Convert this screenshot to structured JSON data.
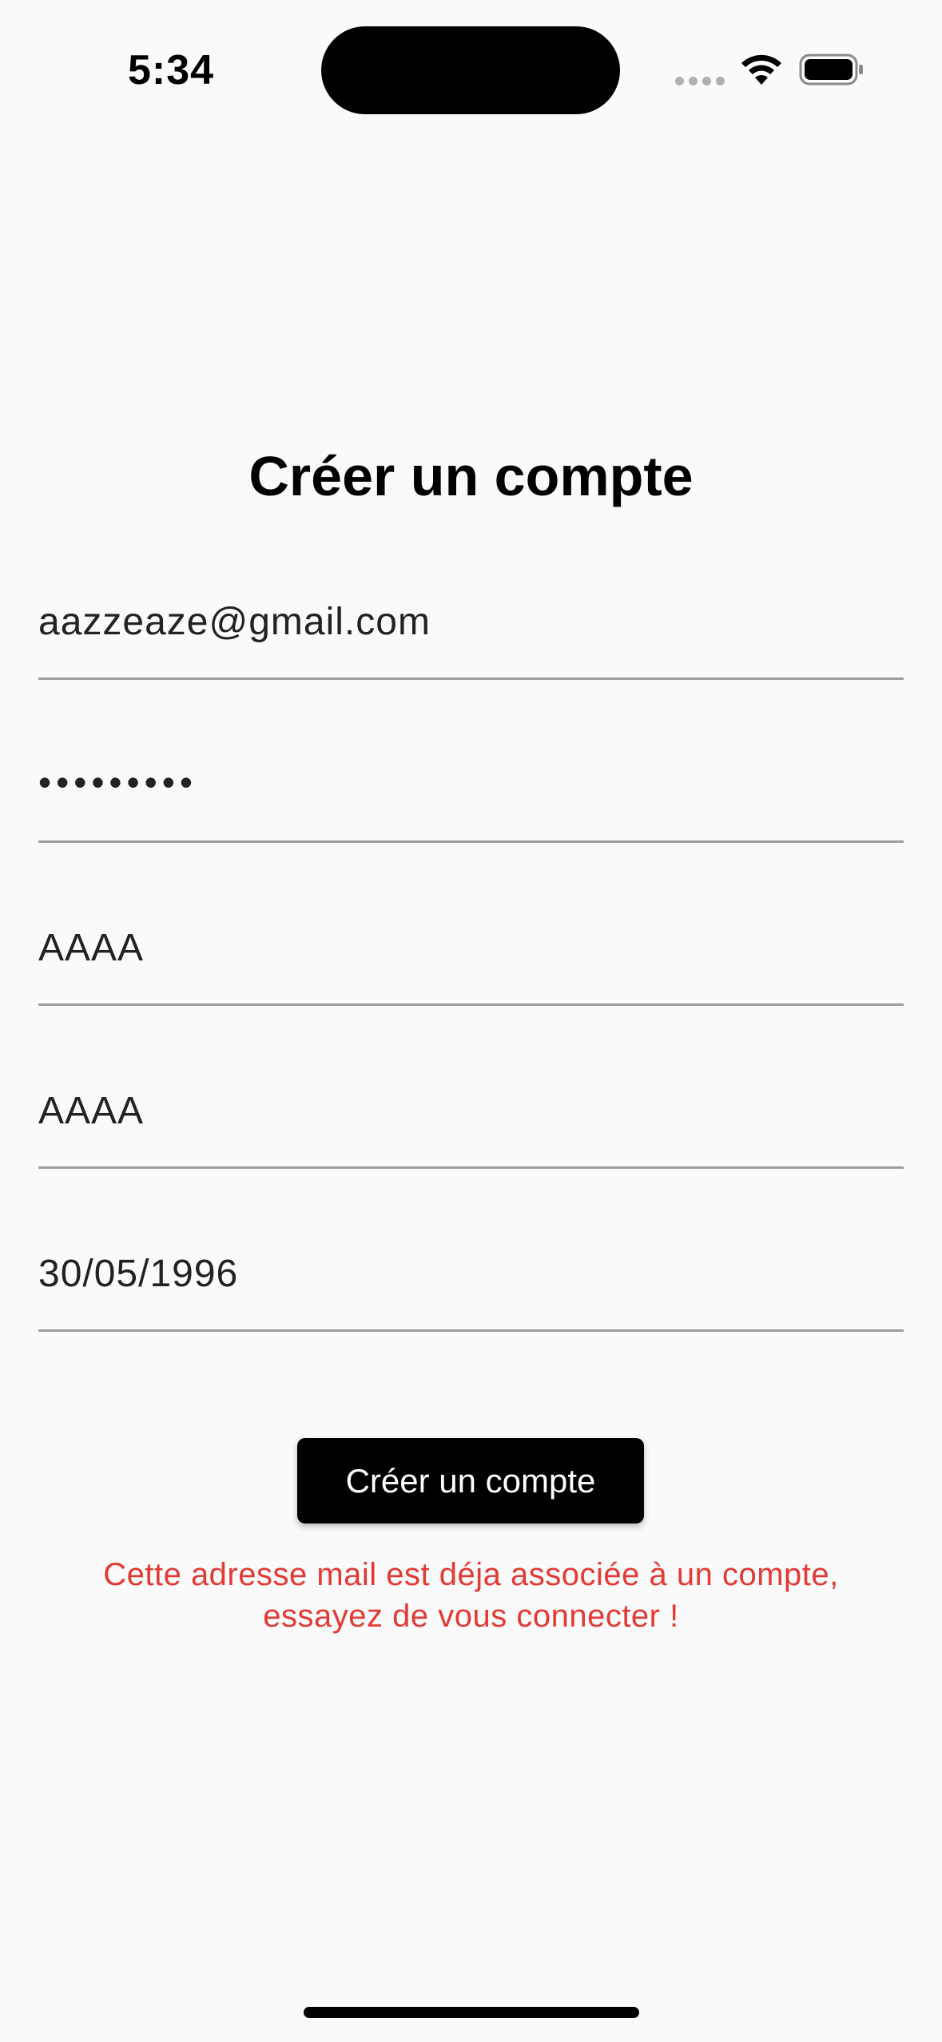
{
  "status_bar": {
    "time": "5:34"
  },
  "page": {
    "title": "Créer un compte"
  },
  "form": {
    "email_value": "aazzeaze@gmail.com",
    "password_value": "•••••••••",
    "last_name_value": "AAAA",
    "first_name_value": "AAAA",
    "birthdate_value": "30/05/1996",
    "submit_label": "Créer un compte",
    "error_message": "Cette adresse mail est déja associée à un compte, essayez de vous connecter !"
  },
  "colors": {
    "background": "#fafafa",
    "error": "#e53935",
    "button": "#000000",
    "underline": "#9e9e9e"
  }
}
